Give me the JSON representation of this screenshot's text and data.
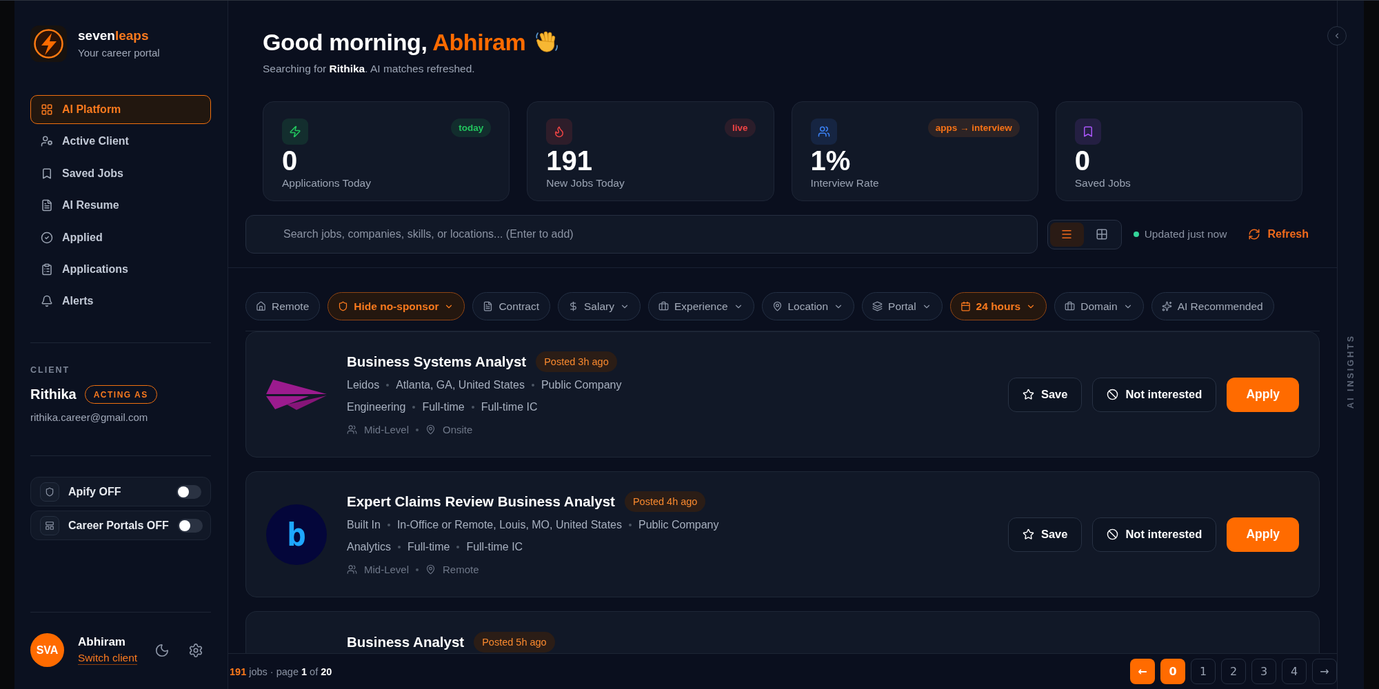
{
  "sidebar": {
    "brand": {
      "name_start": "seven",
      "name_end": "leaps",
      "tagline": "Your career portal"
    },
    "nav": [
      {
        "label": "AI Platform",
        "selected": true
      },
      {
        "label": "Active Client",
        "selected": false
      },
      {
        "label": "Saved Jobs",
        "selected": false
      },
      {
        "label": "AI Resume",
        "selected": false
      },
      {
        "label": "Applied",
        "selected": false
      },
      {
        "label": "Applications",
        "selected": false
      },
      {
        "label": "Alerts",
        "selected": false
      }
    ],
    "client": {
      "heading": "CLIENT",
      "name": "Rithika",
      "badge": "ACTING AS",
      "email": "rithika.career@gmail.com"
    },
    "toggles": [
      {
        "label": "Apify OFF",
        "on": false
      },
      {
        "label": "Career Portals OFF",
        "on": false
      }
    ],
    "user": {
      "initials": "SVA",
      "name": "Abhiram",
      "link": "Switch client"
    }
  },
  "header": {
    "greeting": "Good morning,",
    "name": "Abhiram",
    "subtitle": "Searching for **Rithika**. AI matches refreshed."
  },
  "stats": [
    {
      "value": "0",
      "label": "Applications Today",
      "color": "#22c55e",
      "badge": {
        "text": "today",
        "color": "#22c55e"
      }
    },
    {
      "value": "191",
      "label": "New Jobs Today",
      "color": "#ef4444",
      "badge": {
        "text": "live",
        "color": "#ef4444"
      }
    },
    {
      "value": "1%",
      "label": "Interview Rate",
      "color": "#3b82f6",
      "badge": {
        "text": "apps → interview",
        "color": "#f97316"
      }
    },
    {
      "value": "0",
      "label": "Saved Jobs",
      "color": "#a855f7"
    }
  ],
  "search": {
    "placeholder": "Search jobs, companies, skills, or locations... (Enter to add)"
  },
  "view_modes": [
    {
      "kind": "list",
      "selected": true
    },
    {
      "kind": "grid",
      "selected": false
    }
  ],
  "status": {
    "text": "Updated just now"
  },
  "refresh": {
    "label": "Refresh"
  },
  "filters": [
    {
      "label": "Remote",
      "selected": false,
      "dropdown": false
    },
    {
      "label": "Hide no-sponsor",
      "selected": true,
      "dropdown": true
    },
    {
      "label": "Contract",
      "selected": false,
      "dropdown": false
    },
    {
      "label": "Salary",
      "selected": false,
      "dropdown": true
    },
    {
      "label": "Experience",
      "selected": false,
      "dropdown": true
    },
    {
      "label": "Location",
      "selected": false,
      "dropdown": true
    },
    {
      "label": "Portal",
      "selected": false,
      "dropdown": true
    },
    {
      "label": "24 hours",
      "selected": true,
      "dropdown": true
    },
    {
      "label": "Domain",
      "selected": false,
      "dropdown": true
    },
    {
      "label": "AI Recommended",
      "selected": false,
      "dropdown": false
    }
  ],
  "jobs": [
    {
      "title": "Business Systems Analyst",
      "posted": "Posted 3h ago",
      "logo": {
        "kind": "plane"
      },
      "meta": [
        [
          "Leidos",
          "Atlanta, GA, United States",
          "Public Company"
        ],
        [
          "Engineering",
          "Full-time",
          "Full-time IC"
        ]
      ],
      "seniority": "Mid-Level",
      "work_mode": "Onsite",
      "actions": [
        {
          "kind": "save",
          "label": "Save"
        },
        {
          "kind": "dismiss",
          "label": "Not interested"
        },
        {
          "kind": "apply",
          "label": "Apply"
        }
      ]
    },
    {
      "title": "Expert Claims Review Business Analyst",
      "posted": "Posted 4h ago",
      "logo": {
        "kind": "letter",
        "text": "b"
      },
      "meta": [
        [
          "Built In",
          "In-Office or Remote, Louis, MO, United States",
          "Public Company"
        ],
        [
          "Analytics",
          "Full-time",
          "Full-time IC"
        ]
      ],
      "seniority": "Mid-Level",
      "work_mode": "Remote",
      "actions": [
        {
          "kind": "save",
          "label": "Save"
        },
        {
          "kind": "dismiss",
          "label": "Not interested"
        },
        {
          "kind": "apply",
          "label": "Apply"
        }
      ]
    },
    {
      "title": "Business Analyst",
      "posted": "Posted 5h ago"
    }
  ],
  "footer": {
    "summary": "**191** jobs · page **1** of **20**",
    "prev": {
      "label": "←",
      "highlighted": true
    },
    "pages": [
      {
        "label": "0",
        "selected": true
      },
      {
        "label": "1",
        "selected": false
      },
      {
        "label": "2",
        "selected": false
      },
      {
        "label": "3",
        "selected": false
      },
      {
        "label": "4",
        "selected": false
      }
    ],
    "next": {
      "label": "→",
      "highlighted": false
    }
  },
  "insights_panel": {
    "label": "AI INSIGHTS"
  }
}
